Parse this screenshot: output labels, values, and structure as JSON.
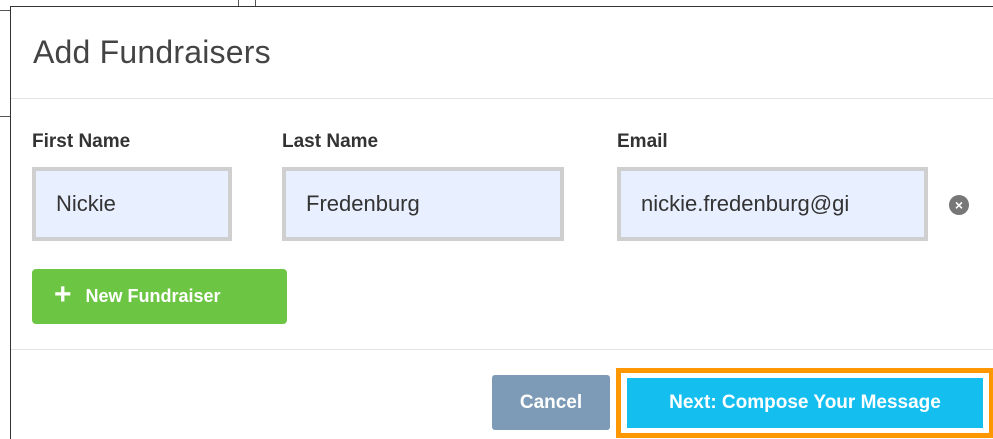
{
  "modal": {
    "title": "Add Fundraisers"
  },
  "fields": {
    "first_name": {
      "label": "First Name",
      "value": "Nickie"
    },
    "last_name": {
      "label": "Last Name",
      "value": "Fredenburg"
    },
    "email": {
      "label": "Email",
      "value": "nickie.fredenburg@gi"
    }
  },
  "actions": {
    "add_label": "New Fundraiser",
    "add_icon": "plus-icon",
    "remove_icon": "close-circle-icon",
    "cancel_label": "Cancel",
    "next_label": "Next: Compose Your Message"
  },
  "colors": {
    "add_button": "#6cc644",
    "cancel_button": "#7d9bb6",
    "next_button": "#14bff0",
    "highlight_outline": "#ff9800",
    "input_bg": "#e8efff"
  }
}
